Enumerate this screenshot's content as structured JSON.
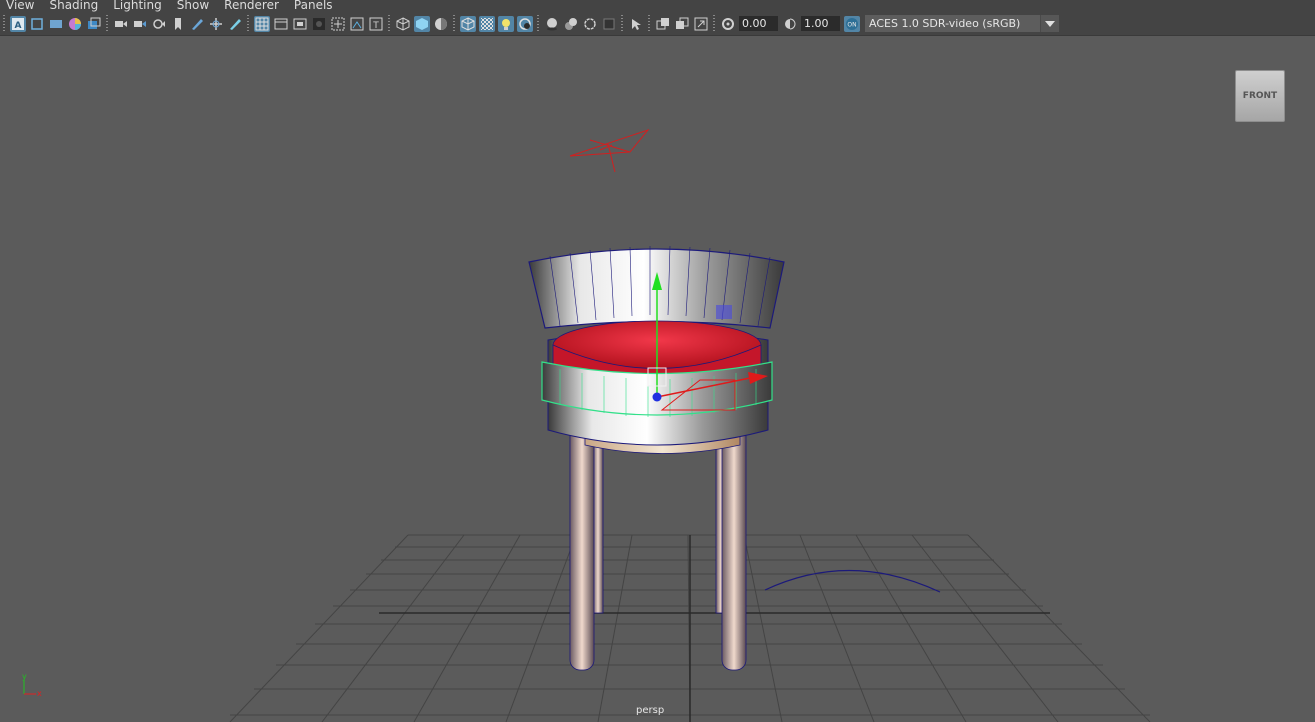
{
  "menu": [
    "View",
    "Shading",
    "Lighting",
    "Show",
    "Renderer",
    "Panels"
  ],
  "toolbar": {
    "exposure_value": "0.00",
    "gamma_value": "1.00",
    "color_space": "ACES 1.0 SDR-video (sRGB)",
    "icons": [
      "select-camera-icon",
      "camera-attributes-icon",
      "bookmark-icon",
      "image-plane-icon",
      "grease-pencil-icon",
      "camera-icon",
      "film-gate-icon",
      "resolution-gate-icon",
      "field-chart-icon",
      "safe-action-icon",
      "safe-title-icon",
      "grid-icon",
      "wireframe-icon",
      "smooth-shade-icon",
      "default-material-icon",
      "xray-icon",
      "textured-icon",
      "lights-icon",
      "shadows-icon",
      "isolate-icon",
      "exposure-icon",
      "gamma-icon",
      "color-management-icon"
    ]
  },
  "viewport": {
    "camera_name": "persp",
    "viewcube_label": "FRONT",
    "axis_labels": {
      "x": "x",
      "y": "y"
    },
    "object": "chair"
  },
  "colors": {
    "background": "#5b5b5b",
    "toolbar": "#444444",
    "accent": "#5285a6"
  }
}
